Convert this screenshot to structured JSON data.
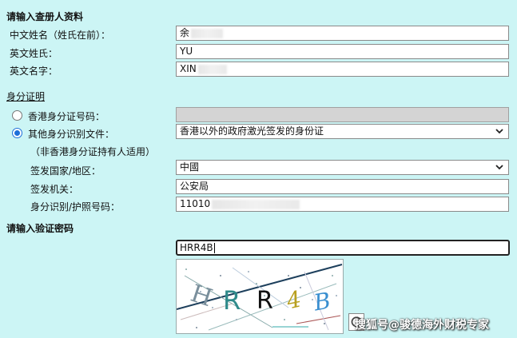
{
  "section_registrant": {
    "title": "请输入查册人资料"
  },
  "fields": {
    "chinese_name": {
      "label": "中文姓名（姓氏在前）：",
      "value": "余"
    },
    "english_surname": {
      "label": "英文姓氏：",
      "value": "YU"
    },
    "english_given": {
      "label": "英文名字：",
      "value": "XIN"
    }
  },
  "section_identity": {
    "title": "身分证明"
  },
  "identity": {
    "hkid_label": "香港身分证号码：",
    "other_label": "其他身分识别文件：",
    "other_note": "（非香港身分证持有人适用）",
    "doc_type_value": "香港以外的政府激光签发的身份证",
    "country_label": "签发国家/地区：",
    "country_value": "中國",
    "authority_label": "签发机关：",
    "authority_value": "公安局",
    "doc_number_label": "身分识别/护照号码：",
    "doc_number_value": "11010",
    "selected": "other"
  },
  "section_captcha": {
    "title": "请输入验证密码"
  },
  "captcha": {
    "input_value": "HRR4B",
    "chars": [
      "H",
      "R",
      "R",
      "4",
      "B"
    ],
    "char_colors": [
      "#7a8f9c",
      "#2f8a8a",
      "#111111",
      "#b8a020",
      "#3a8fd0"
    ]
  },
  "watermark": {
    "text": "搜狐号@骏德海外财税专家"
  },
  "colors": {
    "background": "#ccf5f5",
    "radio_accent": "#1e6fd9"
  },
  "icons": {
    "select_arrow": "chevron-down-icon",
    "refresh": "refresh-icon"
  }
}
